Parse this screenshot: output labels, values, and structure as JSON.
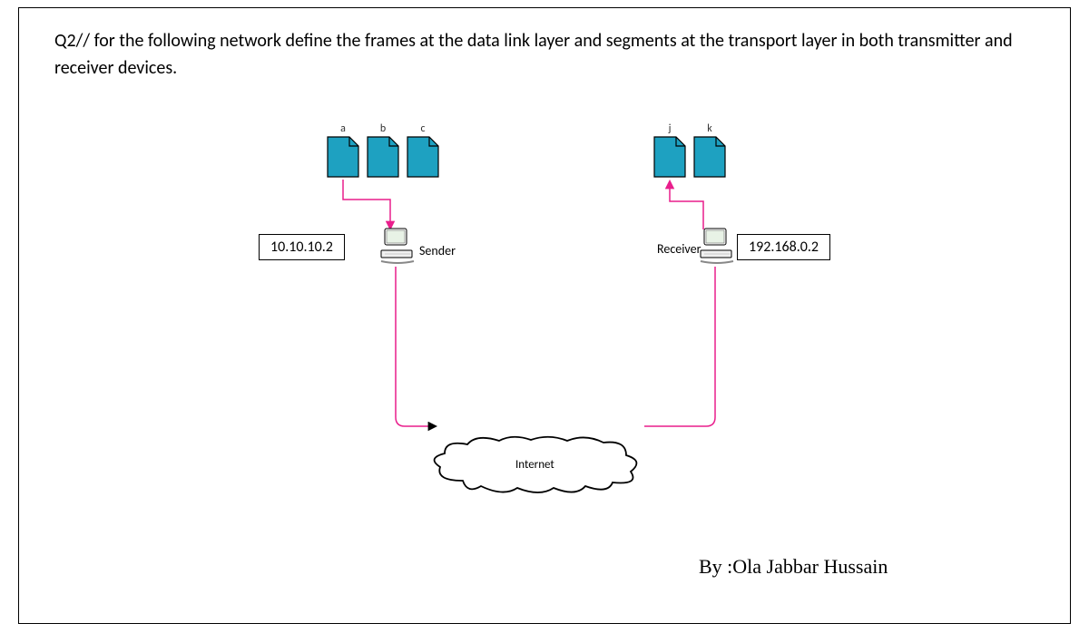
{
  "question": {
    "text": "Q2//   for the following network define the frames at the data link layer and segments at the transport layer in both transmitter and receiver devices."
  },
  "sender": {
    "ip": "10.10.10.2",
    "label": "Sender",
    "docs": {
      "a": "a",
      "b": "b",
      "c": "c"
    }
  },
  "receiver": {
    "ip": "192.168.0.2",
    "label": "Receiver",
    "docs": {
      "j": "j",
      "k": "k"
    }
  },
  "network": {
    "cloud_label": "Internet"
  },
  "byline": "By :Ola Jabbar Hussain",
  "colors": {
    "doc_fill": "#1ea1c1",
    "doc_stroke": "#000000",
    "magenta": "#e91e8c",
    "cloud_stroke": "#000000"
  }
}
